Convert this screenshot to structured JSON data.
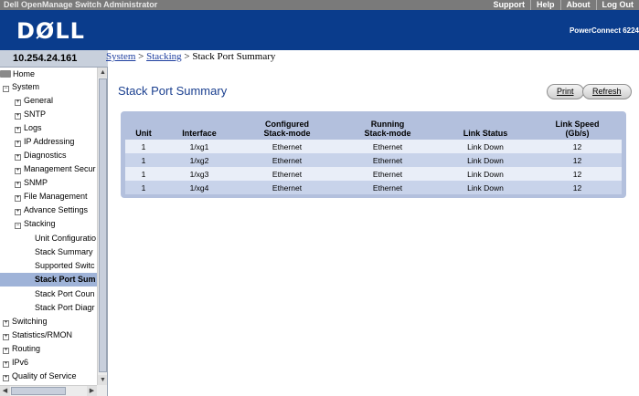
{
  "topbar": {
    "app_title": "Dell OpenManage Switch Administrator",
    "links": [
      "Support",
      "Help",
      "About",
      "Log Out"
    ]
  },
  "banner": {
    "logo_text": "DØLL",
    "product_text": "PowerConnect 6224"
  },
  "ip_address": "10.254.24.161",
  "breadcrumb": {
    "system": "System",
    "sep1": " > ",
    "stacking": "Stacking",
    "sep2": " > ",
    "current": "Stack Port Summary"
  },
  "nav": {
    "home": "Home",
    "system": "System",
    "general": "General",
    "sntp": "SNTP",
    "logs": "Logs",
    "ip_addressing": "IP Addressing",
    "diagnostics": "Diagnostics",
    "management_security": "Management Secur",
    "snmp": "SNMP",
    "file_management": "File Management",
    "advance_settings": "Advance Settings",
    "stacking": "Stacking",
    "unit_configuration": "Unit Configuratio",
    "stack_summary": "Stack Summary",
    "supported_switches": "Supported Switc",
    "stack_port_summary": "Stack Port Sum",
    "stack_port_counters": "Stack Port Coun",
    "stack_port_diagnostics": "Stack Port Diagr",
    "switching": "Switching",
    "statistics_rmon": "Statistics/RMON",
    "routing": "Routing",
    "ipv6": "IPv6",
    "quality_of_service": "Quality of Service"
  },
  "main": {
    "title": "Stack Port Summary",
    "print_label": "Print",
    "refresh_label": "Refresh"
  },
  "table": {
    "headers": {
      "unit": "Unit",
      "interface": "Interface",
      "configured_1": "Configured",
      "configured_2": "Stack-mode",
      "running_1": "Running",
      "running_2": "Stack-mode",
      "link_status": "Link Status",
      "link_speed_1": "Link Speed",
      "link_speed_2": "(Gb/s)"
    },
    "rows": [
      {
        "unit": "1",
        "interface": "1/xg1",
        "configured": "Ethernet",
        "running": "Ethernet",
        "link_status": "Link Down",
        "link_speed": "12"
      },
      {
        "unit": "1",
        "interface": "1/xg2",
        "configured": "Ethernet",
        "running": "Ethernet",
        "link_status": "Link Down",
        "link_speed": "12"
      },
      {
        "unit": "1",
        "interface": "1/xg3",
        "configured": "Ethernet",
        "running": "Ethernet",
        "link_status": "Link Down",
        "link_speed": "12"
      },
      {
        "unit": "1",
        "interface": "1/xg4",
        "configured": "Ethernet",
        "running": "Ethernet",
        "link_status": "Link Down",
        "link_speed": "12"
      }
    ]
  },
  "colors": {
    "banner": "#0a3c8c",
    "title": "#1a3f8f",
    "table_frame": "#b3c0dd",
    "row_light": "#e9eef8",
    "row_dark": "#c8d3ea",
    "nav_selected": "#9fb3d8"
  }
}
